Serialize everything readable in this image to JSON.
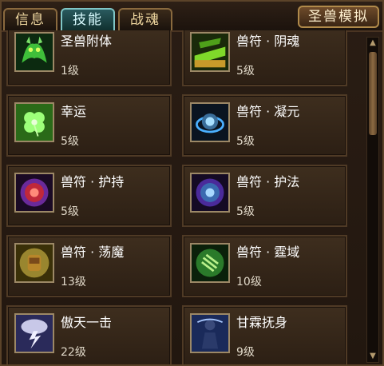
{
  "tabs": [
    {
      "label": "信息",
      "active": false
    },
    {
      "label": "技能",
      "active": true
    },
    {
      "label": "战魂",
      "active": false
    }
  ],
  "simulate_button": "圣兽模拟",
  "skills": [
    {
      "name": "圣兽附体",
      "level": "1级",
      "icon": "green-dragon-icon"
    },
    {
      "name": "兽符 · 阴魂",
      "level": "5级",
      "icon": "green-gold-beast-icon"
    },
    {
      "name": "幸运",
      "level": "5级",
      "icon": "four-leaf-clover-icon"
    },
    {
      "name": "兽符 · 凝元",
      "level": "5级",
      "icon": "blue-orb-rune-icon"
    },
    {
      "name": "兽符 · 护持",
      "level": "5级",
      "icon": "red-purple-rune-icon"
    },
    {
      "name": "兽符 · 护法",
      "level": "5级",
      "icon": "blue-purple-rune-icon"
    },
    {
      "name": "兽符 · 荡魔",
      "level": "13级",
      "icon": "gold-fist-icon"
    },
    {
      "name": "兽符 · 霆域",
      "level": "10级",
      "icon": "green-claw-icon"
    },
    {
      "name": "傲天一击",
      "level": "22级",
      "icon": "lightning-storm-icon"
    },
    {
      "name": "甘霖抚身",
      "level": "9级",
      "icon": "blue-figure-icon"
    }
  ],
  "colors": {
    "active_tab": "#2a5a5e",
    "name_text": "#ffffff",
    "level_text": "#e0d8c8"
  }
}
